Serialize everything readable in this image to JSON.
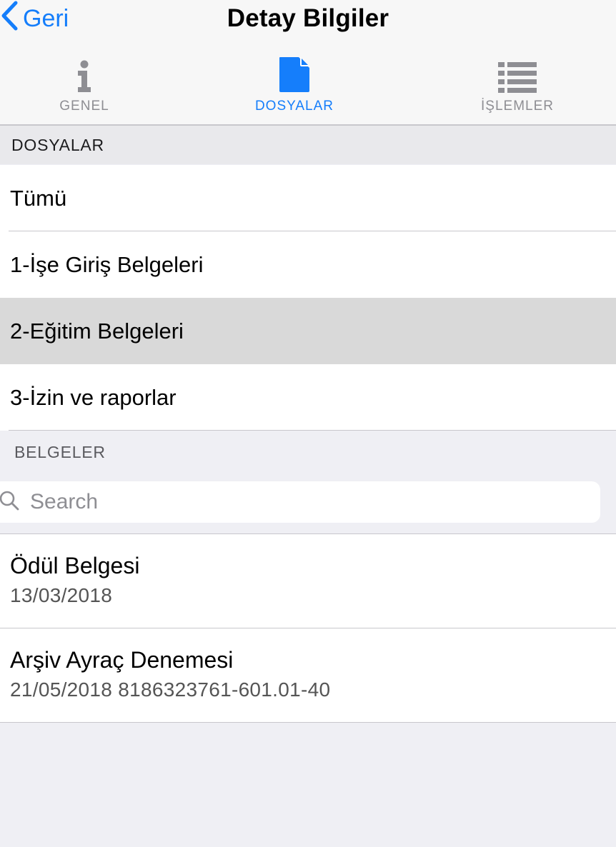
{
  "navbar": {
    "back_label": "Geri",
    "title": "Detay Bilgiler"
  },
  "tabs": [
    {
      "label": "GENEL",
      "icon": "info-icon",
      "active": false
    },
    {
      "label": "DOSYALAR",
      "icon": "document-icon",
      "active": true
    },
    {
      "label": "İŞLEMLER",
      "icon": "list-icon",
      "active": false
    }
  ],
  "folders": {
    "header": "DOSYALAR",
    "items": [
      {
        "label": "Tümü",
        "selected": false
      },
      {
        "label": "1-İşe Giriş Belgeleri",
        "selected": false
      },
      {
        "label": "2-Eğitim Belgeleri",
        "selected": true
      },
      {
        "label": "3-İzin ve raporlar",
        "selected": false
      }
    ]
  },
  "documents": {
    "header": "BELGELER",
    "search": {
      "placeholder": "Search",
      "value": ""
    },
    "items": [
      {
        "title": "Ödül Belgesi",
        "subtitle": "13/03/2018"
      },
      {
        "title": "Arşiv Ayraç Denemesi",
        "subtitle": "21/05/2018 8186323761-601.01-40"
      }
    ]
  },
  "colors": {
    "accent": "#157efb",
    "inactive": "#8e8e93",
    "selected_row": "#d9d9d9",
    "background": "#efeff4"
  }
}
